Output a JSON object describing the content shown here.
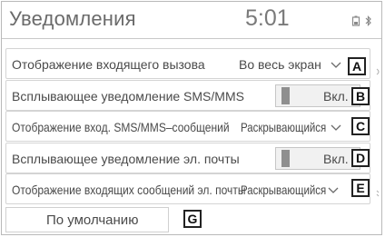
{
  "header": {
    "title": "Уведомления",
    "time": "5:01"
  },
  "settings": [
    {
      "label": "Отображение входящего вызова",
      "value": "Во весь экран",
      "callout": "A"
    },
    {
      "label": "Всплывающее уведомление SMS/MMS",
      "toggle": "Вкл.",
      "callout": "B"
    },
    {
      "label": "Отображение вход. SMS/MMS–сообщений",
      "value": "Раскрывающийся",
      "callout": "C"
    },
    {
      "label": "Всплывающее уведомление эл. почты",
      "toggle": "Вкл.",
      "callout": "D"
    },
    {
      "label": "Отображение входящих сообщений эл. почты",
      "value": "Раскрывающийся",
      "callout": "E"
    }
  ],
  "footer": {
    "default_label": "По умолчанию",
    "callout": "G"
  },
  "colors": {
    "text": "#4a4a4a",
    "border": "#d4d4d4",
    "knob": "#8f8f8f",
    "toggle_bg": "#f1f1f1",
    "callout_border": "#222222"
  },
  "icons": [
    "phone-battery-icon",
    "bluetooth-icon",
    "chevron-down-icon"
  ]
}
